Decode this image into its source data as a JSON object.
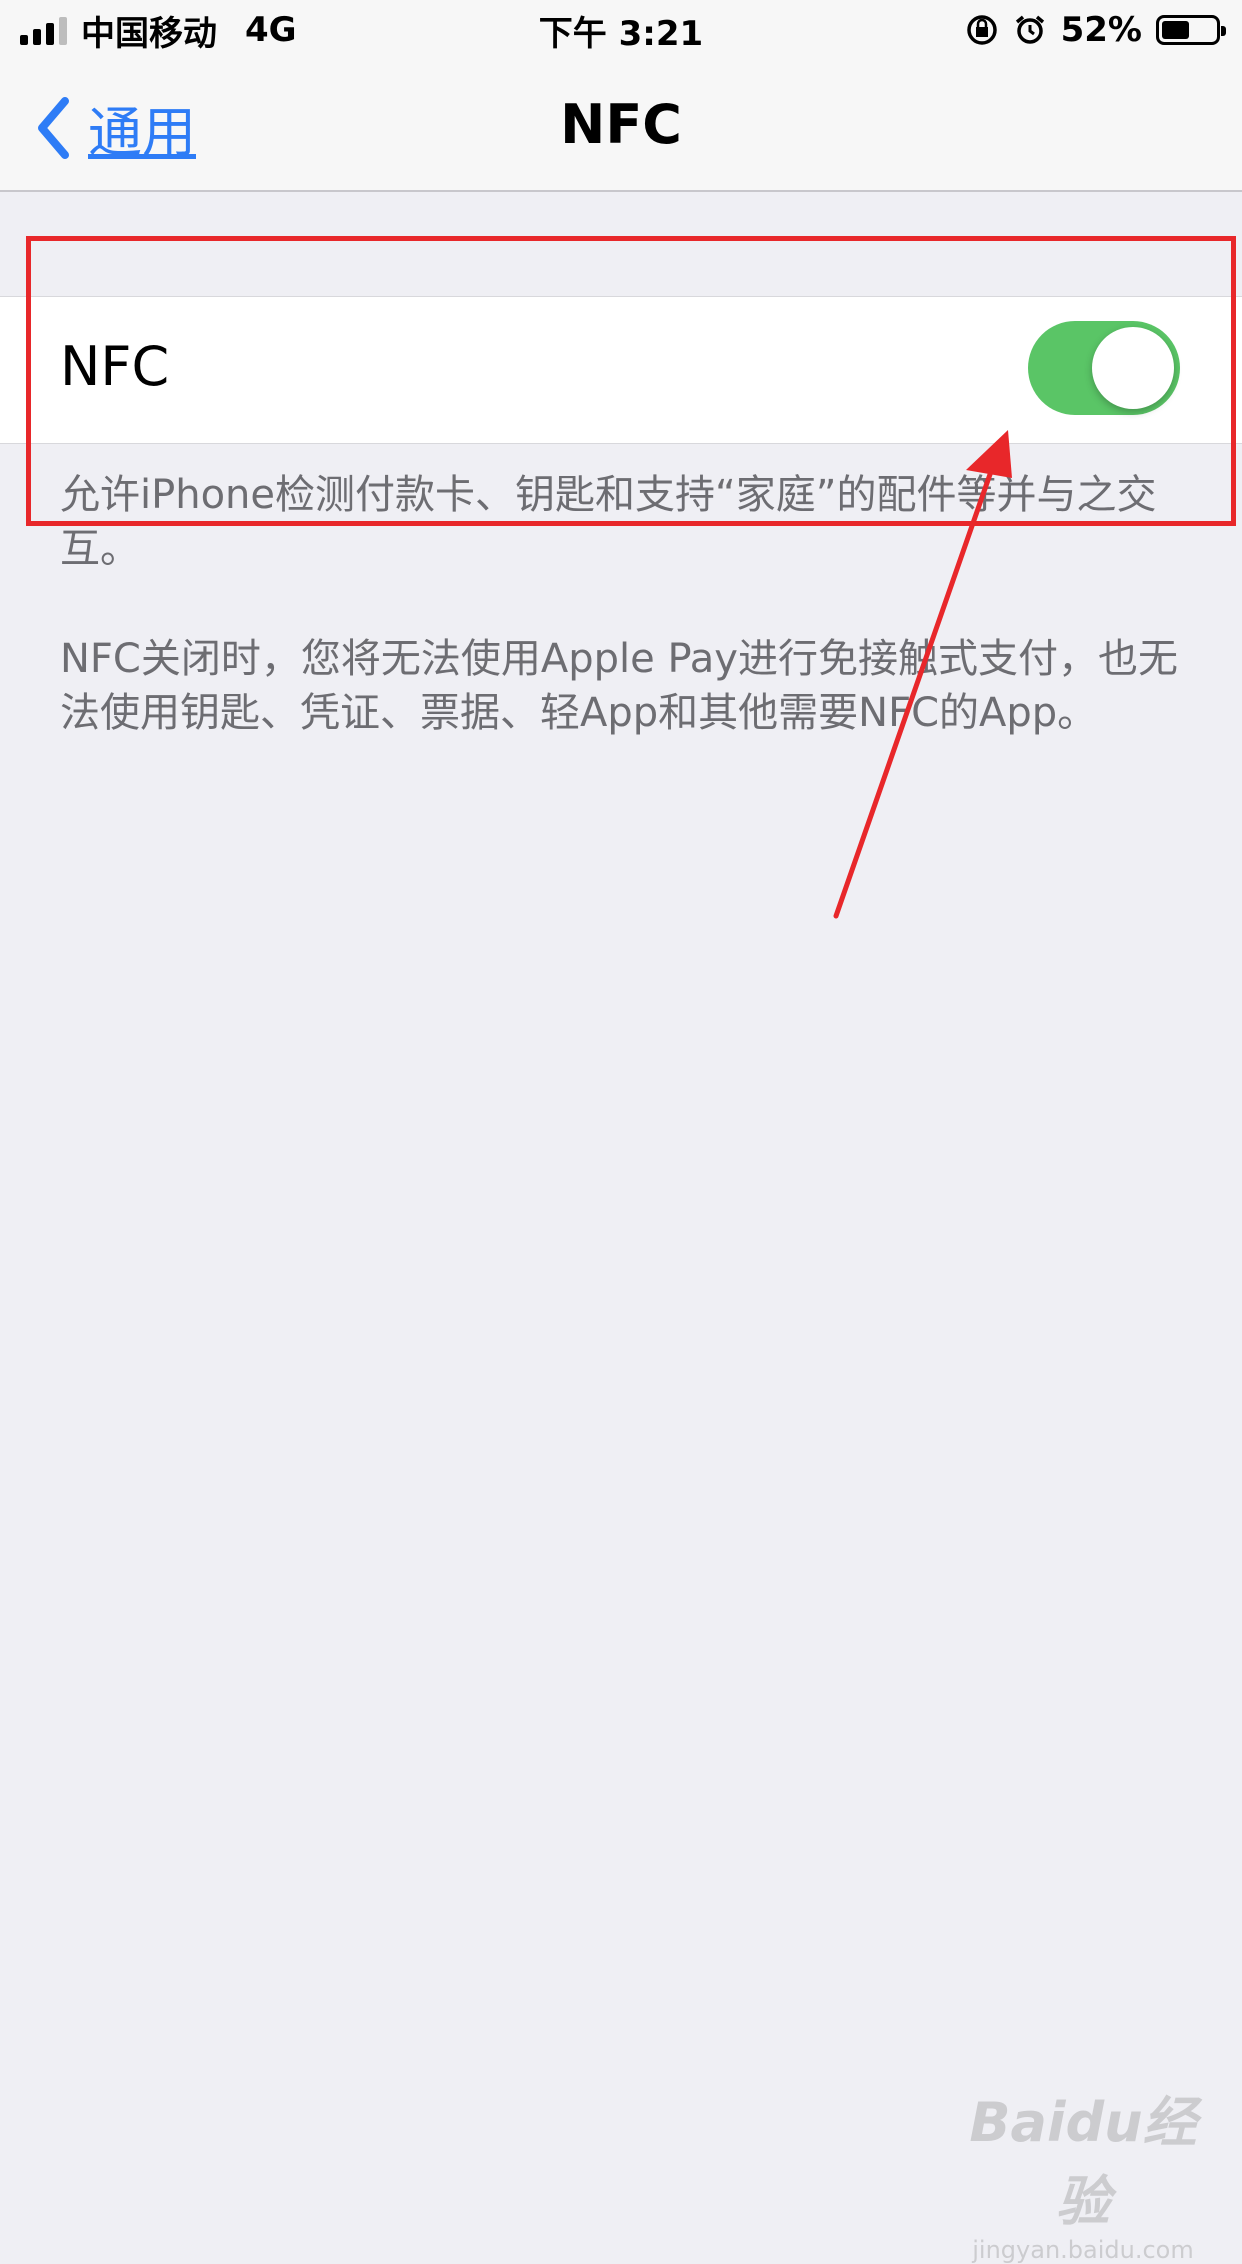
{
  "status_bar": {
    "carrier": "中国移动",
    "network": "4G",
    "time": "下午 3:21",
    "battery_percent": "52%",
    "battery_level": 0.52,
    "icons": [
      "signal-icon",
      "rotation-lock-icon",
      "alarm-icon",
      "battery-icon"
    ]
  },
  "navbar": {
    "back_label": "通用",
    "title": "NFC"
  },
  "nfc_row": {
    "label": "NFC",
    "toggle_on": true,
    "toggle_color": "#5ac566"
  },
  "footer": {
    "description": "允许iPhone检测付款卡、钥匙和支持“家庭”的配件等并与之交互。",
    "warning": "NFC关闭时，您将无法使用Apple Pay进行免接触式支付，也无法使用钥匙、凭证、票据、轻App和其他需要NFC的App。"
  },
  "annotation": {
    "color": "#e8272a"
  },
  "watermark": {
    "logo": "Baidu经验",
    "url": "jingyan.baidu.com"
  },
  "colors": {
    "accent": "#2e7cf6",
    "background": "#efeff4"
  }
}
